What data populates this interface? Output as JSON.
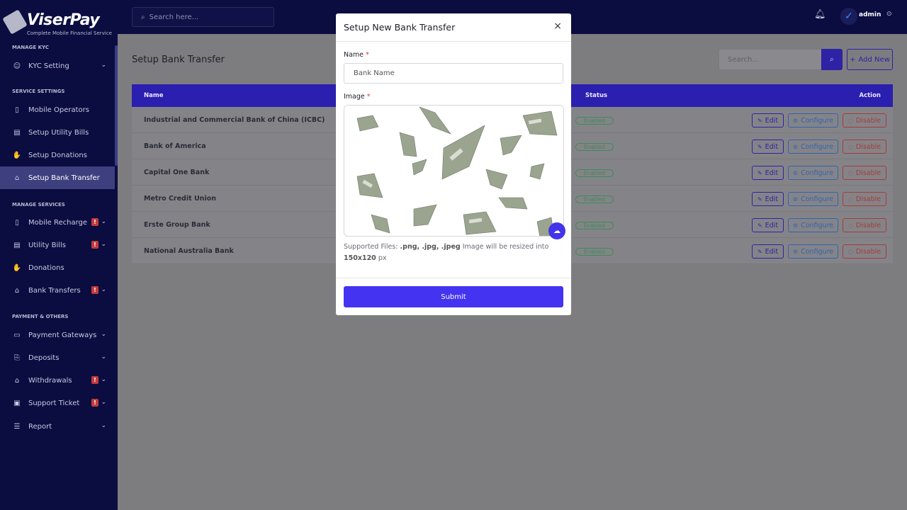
{
  "brand": {
    "name": "ViserPay",
    "tagline": "Complete Mobile Financial Service"
  },
  "topbar": {
    "search_placeholder": "Search here...",
    "user_name": "admin",
    "avatar_glyph": "✓"
  },
  "sidebar": {
    "sections": [
      {
        "title": "MANAGE KYC",
        "items": [
          {
            "label": "KYC Setting",
            "icon": "user-check-icon",
            "chevron": true
          }
        ]
      },
      {
        "title": "SERVICE SETTINGS",
        "items": [
          {
            "label": "Mobile Operators",
            "icon": "mobile-icon"
          },
          {
            "label": "Setup Utility Bills",
            "icon": "receipt-icon"
          },
          {
            "label": "Setup Donations",
            "icon": "hand-donate-icon"
          },
          {
            "label": "Setup Bank Transfer",
            "icon": "bank-icon",
            "active": true
          }
        ]
      },
      {
        "title": "MANAGE SERVICES",
        "items": [
          {
            "label": "Mobile Recharge",
            "icon": "mobile-icon",
            "warning": true,
            "chevron": true
          },
          {
            "label": "Utility Bills",
            "icon": "receipt-icon",
            "warning": true,
            "chevron": true
          },
          {
            "label": "Donations",
            "icon": "hand-donate-icon"
          },
          {
            "label": "Bank Transfers",
            "icon": "bank-icon",
            "warning": true,
            "chevron": true
          }
        ]
      },
      {
        "title": "PAYMENT & OTHERS",
        "items": [
          {
            "label": "Payment Gateways",
            "icon": "credit-card-icon",
            "chevron": true
          },
          {
            "label": "Deposits",
            "icon": "deposit-icon",
            "chevron": true
          },
          {
            "label": "Withdrawals",
            "icon": "bank-icon",
            "warning": true,
            "chevron": true
          },
          {
            "label": "Support Ticket",
            "icon": "ticket-icon",
            "warning": true,
            "chevron": true
          },
          {
            "label": "Report",
            "icon": "list-icon",
            "chevron": true
          }
        ]
      }
    ]
  },
  "main": {
    "title": "Setup Bank Transfer",
    "search_placeholder": "Search...",
    "add_new_label": "Add New",
    "table": {
      "headers": {
        "name": "Name",
        "status": "Status",
        "action": "Action"
      },
      "rows": [
        {
          "name": "Industrial and Commercial Bank of China (ICBC)",
          "status": "Enabled"
        },
        {
          "name": "Bank of America",
          "status": "Enabled"
        },
        {
          "name": "Capital One Bank",
          "status": "Enabled"
        },
        {
          "name": "Metro Credit Union",
          "status": "Enabled"
        },
        {
          "name": "Erste Group Bank",
          "status": "Enabled"
        },
        {
          "name": "National Australia Bank",
          "status": "Enabled"
        }
      ],
      "actions": {
        "edit": "Edit",
        "configure": "Configure",
        "disable": "Disable"
      }
    }
  },
  "modal": {
    "title": "Setup New Bank Transfer",
    "name_label": "Name",
    "name_placeholder": "Bank Name",
    "image_label": "Image",
    "required_mark": "*",
    "support_prefix": "Supported Files: ",
    "support_types": ".png, .jpg, .jpeg",
    "support_middle": " Image will be resized into ",
    "support_size": "150x120",
    "support_suffix": " px",
    "submit_label": "Submit"
  },
  "colors": {
    "sidebar_bg": "#0b0c3f",
    "accent": "#4433f0",
    "enabled": "#3e8a5a",
    "danger": "#a83a3a"
  }
}
